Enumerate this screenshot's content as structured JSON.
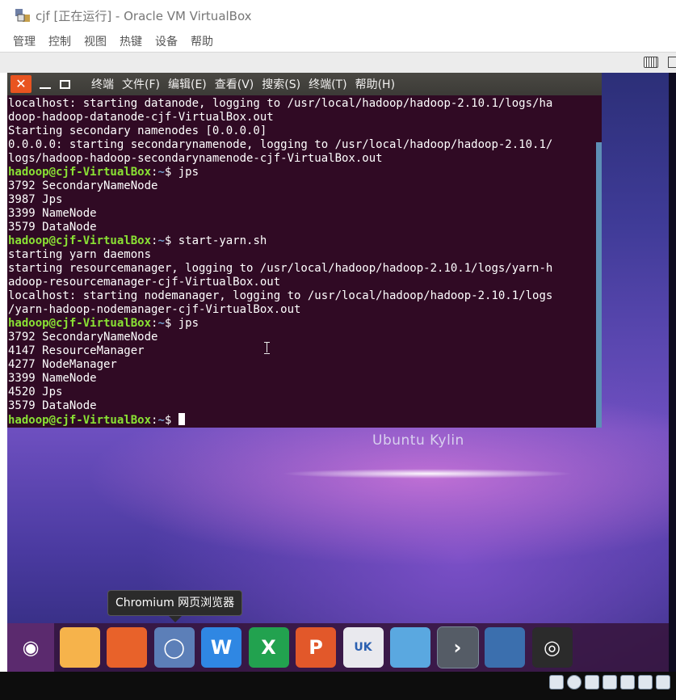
{
  "window": {
    "title": "cjf [正在运行] - Oracle VM VirtualBox",
    "menu": [
      "管理",
      "控制",
      "视图",
      "热键",
      "设备",
      "帮助"
    ]
  },
  "terminal": {
    "close_glyph": "✕",
    "menu": [
      "终端",
      "文件(F)",
      "编辑(E)",
      "查看(V)",
      "搜索(S)",
      "终端(T)",
      "帮助(H)"
    ],
    "prompt_user": "hadoop@cjf-VirtualBox",
    "prompt_sep": ":",
    "prompt_path": "~",
    "prompt_symbol": "$ ",
    "lines": [
      {
        "type": "out",
        "text": "localhost: starting datanode, logging to /usr/local/hadoop/hadoop-2.10.1/logs/ha"
      },
      {
        "type": "out",
        "text": "doop-hadoop-datanode-cjf-VirtualBox.out"
      },
      {
        "type": "out",
        "text": "Starting secondary namenodes [0.0.0.0]"
      },
      {
        "type": "out",
        "text": "0.0.0.0: starting secondarynamenode, logging to /usr/local/hadoop/hadoop-2.10.1/"
      },
      {
        "type": "out",
        "text": "logs/hadoop-hadoop-secondarynamenode-cjf-VirtualBox.out"
      },
      {
        "type": "prompt",
        "text": "jps"
      },
      {
        "type": "out",
        "text": "3792 SecondaryNameNode"
      },
      {
        "type": "out",
        "text": "3987 Jps"
      },
      {
        "type": "out",
        "text": "3399 NameNode"
      },
      {
        "type": "out",
        "text": "3579 DataNode"
      },
      {
        "type": "prompt",
        "text": "start-yarn.sh"
      },
      {
        "type": "out",
        "text": "starting yarn daemons"
      },
      {
        "type": "out",
        "text": "starting resourcemanager, logging to /usr/local/hadoop/hadoop-2.10.1/logs/yarn-h"
      },
      {
        "type": "out",
        "text": "adoop-resourcemanager-cjf-VirtualBox.out"
      },
      {
        "type": "out",
        "text": "localhost: starting nodemanager, logging to /usr/local/hadoop/hadoop-2.10.1/logs"
      },
      {
        "type": "out",
        "text": "/yarn-hadoop-nodemanager-cjf-VirtualBox.out"
      },
      {
        "type": "prompt",
        "text": "jps"
      },
      {
        "type": "out",
        "text": "3792 SecondaryNameNode"
      },
      {
        "type": "out",
        "text": "4147 ResourceManager"
      },
      {
        "type": "out",
        "text": "4277 NodeManager"
      },
      {
        "type": "out",
        "text": "3399 NameNode"
      },
      {
        "type": "out",
        "text": "4520 Jps"
      },
      {
        "type": "out",
        "text": "3579 DataNode"
      },
      {
        "type": "prompt_cursor",
        "text": ""
      }
    ]
  },
  "desktop": {
    "logo_text": "Ubuntu Kylin"
  },
  "tooltip": {
    "text": "Chromium 网页浏览器"
  },
  "dock": {
    "items": [
      {
        "name": "ubuntu-kylin-launcher-icon",
        "glyph": "◉",
        "color": "#5b2a6e"
      },
      {
        "name": "files-icon",
        "glyph": "",
        "color": "#f6b34b"
      },
      {
        "name": "firefox-icon",
        "glyph": "",
        "color": "#e8622a"
      },
      {
        "name": "chromium-icon",
        "glyph": "◯",
        "color": "#5c7fb8"
      },
      {
        "name": "wps-writer-icon",
        "glyph": "W",
        "color": "#2f87e3"
      },
      {
        "name": "wps-spreadsheets-icon",
        "glyph": "X",
        "color": "#22a24f"
      },
      {
        "name": "wps-presentation-icon",
        "glyph": "P",
        "color": "#e2582a"
      },
      {
        "name": "ubuntu-kylin-software-center-icon",
        "glyph": "UK",
        "color": "#e9e9ee"
      },
      {
        "name": "youker-assistant-icon",
        "glyph": "",
        "color": "#5aa8e0"
      },
      {
        "name": "terminal-icon",
        "glyph": "›",
        "color": "#555c66"
      },
      {
        "name": "workspace-switcher-icon",
        "glyph": "",
        "color": "#3b6fae"
      },
      {
        "name": "dvd-icon",
        "glyph": "◎",
        "color": "#2b2b2b"
      }
    ]
  }
}
